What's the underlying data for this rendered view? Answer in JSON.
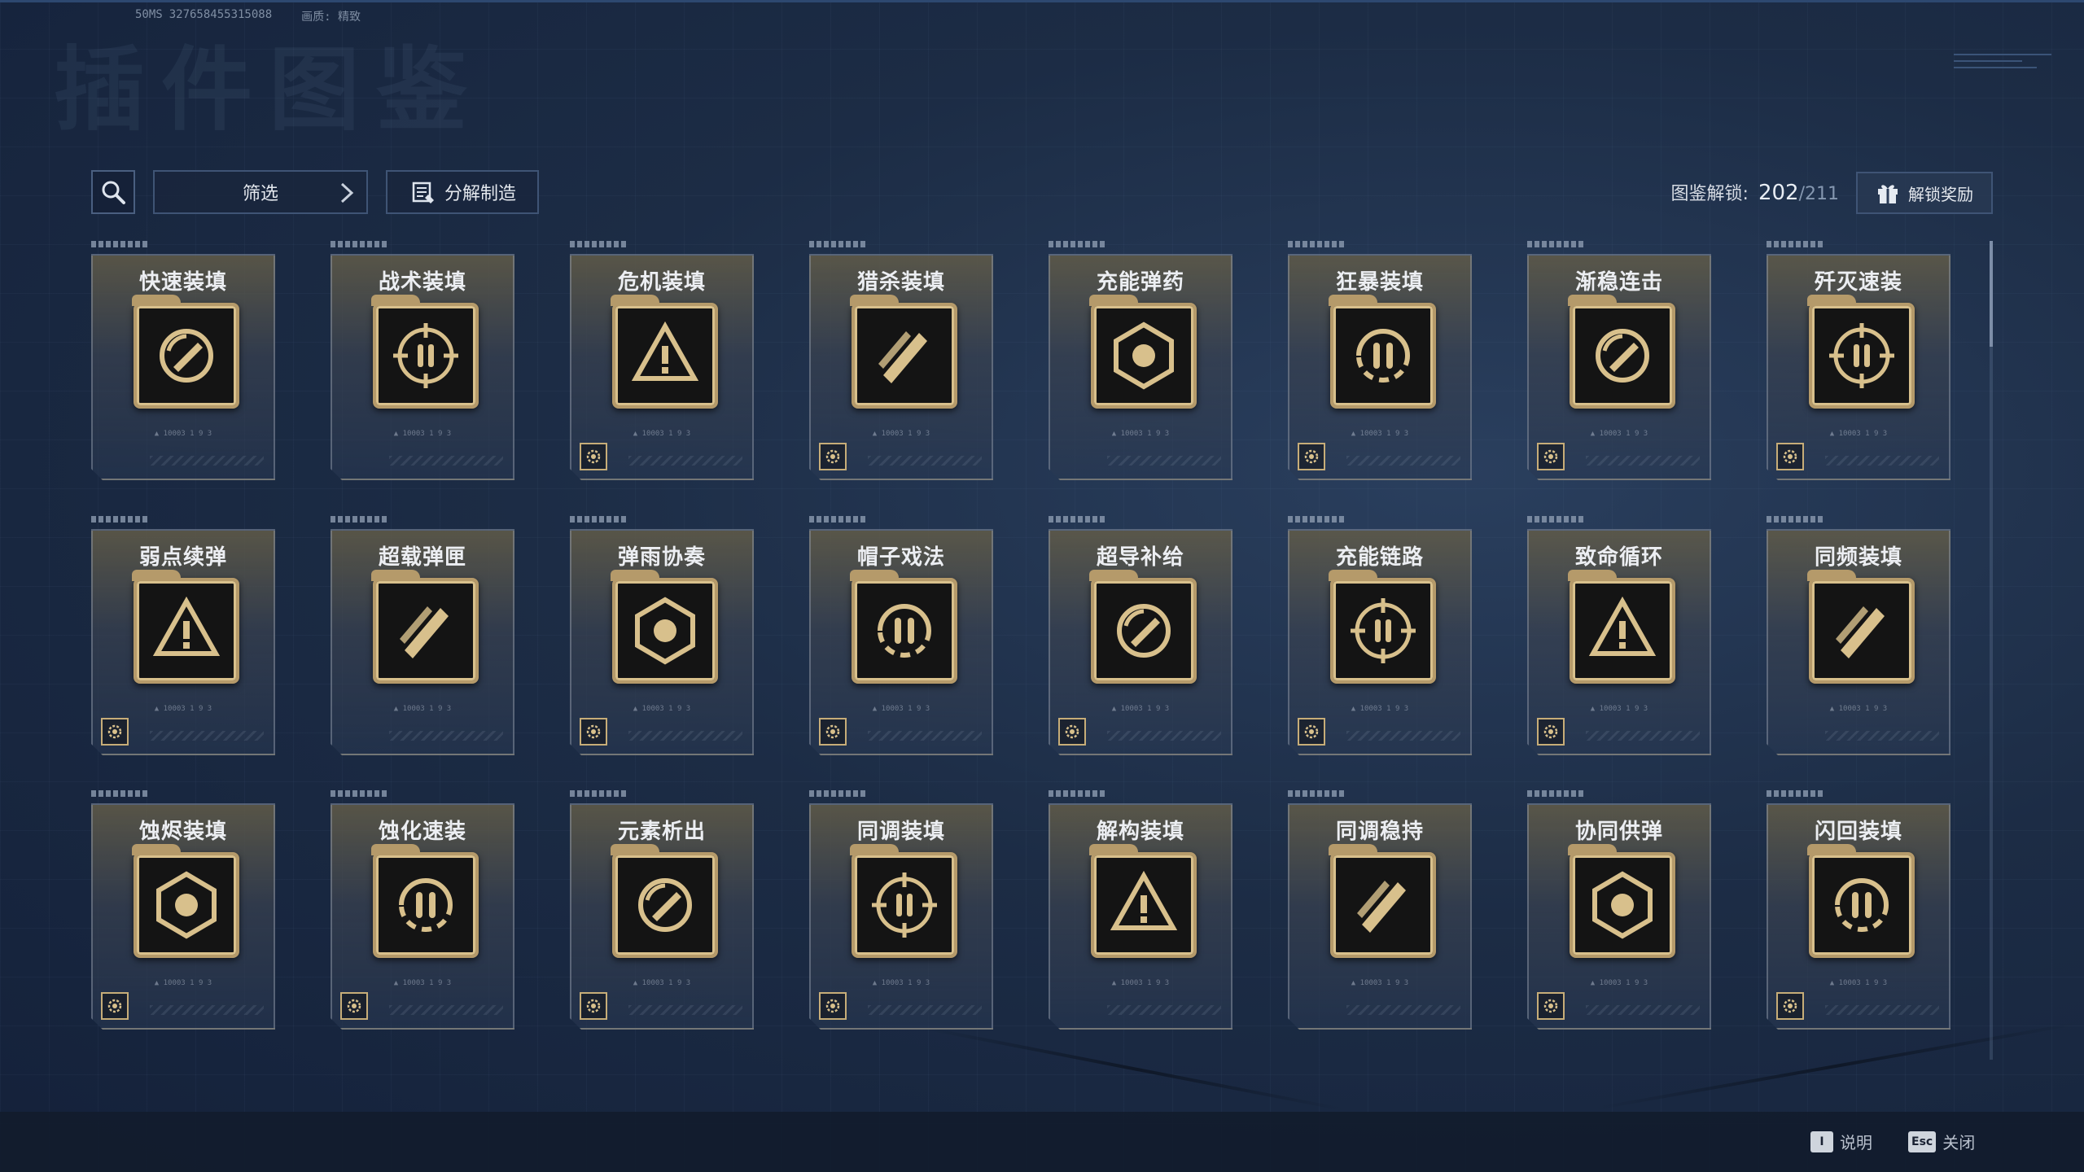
{
  "meta": {
    "fps": "50MS",
    "id": "327658455315088",
    "quality_label": "画质: 精致"
  },
  "page_title_watermark": "插件图鉴",
  "toolbar": {
    "search_icon": "search-icon",
    "filter_label": "筛选",
    "craft_label": "分解制造",
    "unlock_label": "图鉴解锁:",
    "unlock_count": "202",
    "unlock_total": "/211",
    "reward_label": "解锁奖励"
  },
  "cards": [
    {
      "title": "快速装填",
      "icon": "rocket-cycle-icon",
      "badge": false,
      "caption": "▲ 10003 1 9 3"
    },
    {
      "title": "战术装填",
      "icon": "tactical-soldier-icon",
      "badge": false,
      "caption": "▲ 10003 1 9 3"
    },
    {
      "title": "危机装填",
      "icon": "bullets-warning-icon",
      "badge": true,
      "caption": "▲ 10003 1 9 3"
    },
    {
      "title": "猎杀装填",
      "icon": "crosshair-bullets-icon",
      "badge": true,
      "caption": "▲ 10003 1 9 3"
    },
    {
      "title": "充能弹药",
      "icon": "charged-rounds-icon",
      "badge": false,
      "caption": "▲ 10003 1 9 3"
    },
    {
      "title": "狂暴装填",
      "icon": "berserk-gun-icon",
      "badge": true,
      "caption": "▲ 10003 1 9 3"
    },
    {
      "title": "渐稳连击",
      "icon": "stable-combo-icon",
      "badge": true,
      "caption": "▲ 10003 1 9 3"
    },
    {
      "title": "歼灭速装",
      "icon": "annihilate-arrow-icon",
      "badge": true,
      "caption": "▲ 10003 1 9 3"
    },
    {
      "title": "弱点续弹",
      "icon": "weakpoint-target-icon",
      "badge": true,
      "caption": "▲ 10003 1 9 3"
    },
    {
      "title": "超载弹匣",
      "icon": "overload-mag-icon",
      "badge": false,
      "caption": "▲ 10003 1 9 3"
    },
    {
      "title": "弹雨协奏",
      "icon": "bullet-rain-icon",
      "badge": true,
      "caption": "▲ 10003 1 9 3"
    },
    {
      "title": "帽子戏法",
      "icon": "hat-trick-icon",
      "badge": true,
      "caption": "▲ 10003 1 9 3"
    },
    {
      "title": "超导补给",
      "icon": "superconduct-icon",
      "badge": true,
      "caption": "▲ 10003 1 9 3"
    },
    {
      "title": "充能链路",
      "icon": "charge-link-icon",
      "badge": true,
      "caption": "▲ 10003 1 9 3"
    },
    {
      "title": "致命循环",
      "icon": "fatal-loop-icon",
      "badge": true,
      "caption": "▲ 10003 1 9 3"
    },
    {
      "title": "同频装填",
      "icon": "sync-reload-icon",
      "badge": false,
      "caption": "▲ 10003 1 9 3"
    },
    {
      "title": "蚀烬装填",
      "icon": "corrode-burn-icon",
      "badge": true,
      "caption": "▲ 10003 1 9 3"
    },
    {
      "title": "蚀化速装",
      "icon": "corrode-fast-icon",
      "badge": true,
      "caption": "▲ 10003 1 9 3"
    },
    {
      "title": "元素析出",
      "icon": "element-extract-icon",
      "badge": true,
      "caption": "▲ 10003 1 9 3"
    },
    {
      "title": "同调装填",
      "icon": "attune-target-icon",
      "badge": true,
      "caption": "▲ 10003 1 9 3"
    },
    {
      "title": "解构装填",
      "icon": "deconstruct-icon",
      "badge": false,
      "caption": "▲ 10003 1 9 3"
    },
    {
      "title": "同调稳持",
      "icon": "attune-stable-icon",
      "badge": false,
      "caption": "▲ 10003 1 9 3"
    },
    {
      "title": "协同供弹",
      "icon": "coop-supply-icon",
      "badge": true,
      "caption": "▲ 10003 1 9 3"
    },
    {
      "title": "闪回装填",
      "icon": "flashback-icon",
      "badge": true,
      "caption": "▲ 10003 1 9 3"
    }
  ],
  "footer": {
    "help_key": "I",
    "help_label": "说明",
    "close_key": "Esc",
    "close_label": "关闭"
  },
  "colors": {
    "gold": "#d8c08c",
    "tile_bg": "#141414",
    "bg_dark": "#14213a"
  }
}
